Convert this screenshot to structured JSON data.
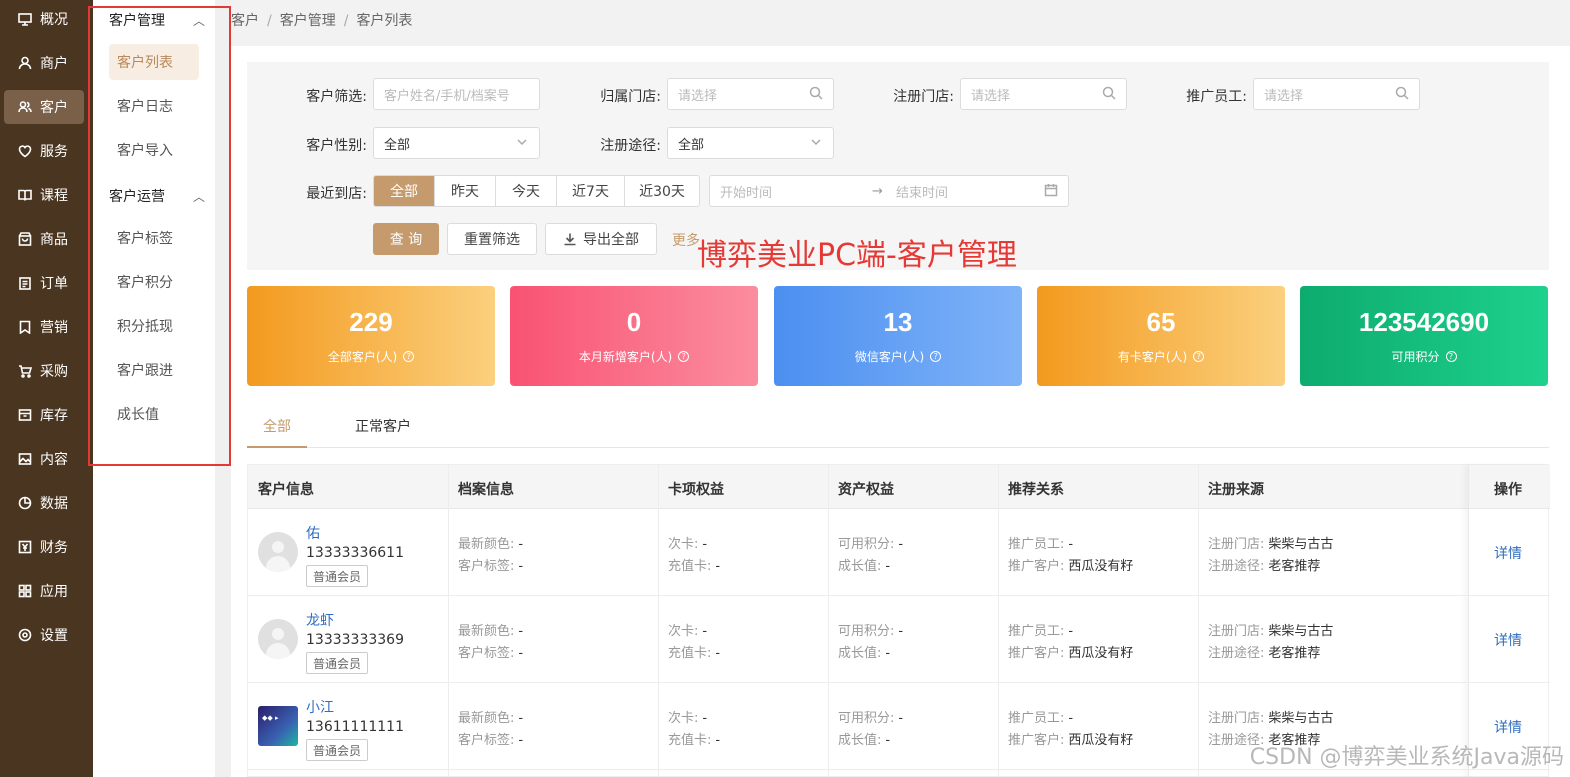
{
  "nav": {
    "items": [
      {
        "label": "概况",
        "icon": "monitor-icon"
      },
      {
        "label": "商户",
        "icon": "user-icon"
      },
      {
        "label": "客户",
        "icon": "users-icon"
      },
      {
        "label": "服务",
        "icon": "heart-icon"
      },
      {
        "label": "课程",
        "icon": "book-icon"
      },
      {
        "label": "商品",
        "icon": "bag-icon"
      },
      {
        "label": "订单",
        "icon": "clipboard-icon"
      },
      {
        "label": "营销",
        "icon": "bookmark-icon"
      },
      {
        "label": "采购",
        "icon": "cart-icon"
      },
      {
        "label": "库存",
        "icon": "box-icon"
      },
      {
        "label": "内容",
        "icon": "image-icon"
      },
      {
        "label": "数据",
        "icon": "pie-icon"
      },
      {
        "label": "财务",
        "icon": "yen-icon"
      },
      {
        "label": "应用",
        "icon": "grid-icon"
      },
      {
        "label": "设置",
        "icon": "gear-icon"
      }
    ],
    "active": "客户"
  },
  "submenu": {
    "group1": "客户管理",
    "group1_items": [
      "客户列表",
      "客户日志",
      "客户导入"
    ],
    "group2": "客户运营",
    "group2_items": [
      "客户标签",
      "客户积分",
      "积分抵现",
      "客户跟进",
      "成长值"
    ],
    "active": "客户列表"
  },
  "breadcrumb": [
    "客户",
    "客户管理",
    "客户列表"
  ],
  "filters": {
    "customer_label": "客户筛选:",
    "customer_placeholder": "客户姓名/手机/档案号",
    "home_store_label": "归属门店:",
    "home_store_placeholder": "请选择",
    "reg_store_label": "注册门店:",
    "reg_store_placeholder": "请选择",
    "promoter_label": "推广员工:",
    "promoter_placeholder": "请选择",
    "gender_label": "客户性别:",
    "gender_value": "全部",
    "channel_label": "注册途径:",
    "channel_value": "全部",
    "recent_label": "最近到店:",
    "recent_options": [
      "全部",
      "昨天",
      "今天",
      "近7天",
      "近30天"
    ],
    "recent_active": "全部",
    "start_placeholder": "开始时间",
    "arrow": "→",
    "end_placeholder": "结束时间",
    "query_btn": "查 询",
    "reset_btn": "重置筛选",
    "export_btn": "导出全部",
    "more": "更多"
  },
  "overlay_title": "博弈美业PC端-客户管理",
  "stats": [
    {
      "value": "229",
      "label": "全部客户(人)"
    },
    {
      "value": "0",
      "label": "本月新增客户(人)"
    },
    {
      "value": "13",
      "label": "微信客户(人)"
    },
    {
      "value": "65",
      "label": "有卡客户(人)"
    },
    {
      "value": "123542690",
      "label": "可用积分"
    }
  ],
  "tabs": [
    "全部",
    "正常客户"
  ],
  "table": {
    "headers": [
      "客户信息",
      "档案信息",
      "卡项权益",
      "资产权益",
      "推荐关系",
      "注册来源",
      "操作"
    ],
    "labels": {
      "color": "最新颜色:",
      "tag": "客户标签:",
      "times_card": "次卡:",
      "stored_card": "充值卡:",
      "points": "可用积分:",
      "growth": "成长值:",
      "promoter": "推广员工:",
      "promo_customer": "推广客户:",
      "reg_store": "注册门店:",
      "reg_channel": "注册途径:",
      "detail": "详情"
    },
    "rows": [
      {
        "name": "佑",
        "phone": "13333336611",
        "level": "普通会员",
        "color": "-",
        "tag": "-",
        "times_card": "-",
        "stored_card": "-",
        "points": "-",
        "growth": "-",
        "promoter": "-",
        "promo_customer": "西瓜没有籽",
        "reg_store": "柴柴与古古",
        "reg_channel": "老客推荐"
      },
      {
        "name": "龙虾",
        "phone": "13333333369",
        "level": "普通会员",
        "color": "-",
        "tag": "-",
        "times_card": "-",
        "stored_card": "-",
        "points": "-",
        "growth": "-",
        "promoter": "-",
        "promo_customer": "西瓜没有籽",
        "reg_store": "柴柴与古古",
        "reg_channel": "老客推荐"
      },
      {
        "name": "小江",
        "phone": "13611111111",
        "level": "普通会员",
        "color": "-",
        "tag": "-",
        "times_card": "-",
        "stored_card": "-",
        "points": "-",
        "growth": "-",
        "promoter": "-",
        "promo_customer": "西瓜没有籽",
        "reg_store": "柴柴与古古",
        "reg_channel": "老客推荐"
      }
    ]
  },
  "watermark": "CSDN @博弈美业系统Java源码",
  "colors": {
    "accent": "#c59a6c",
    "nav_bg": "#4a3520",
    "link": "#2f6ec0",
    "highlight": "#e53935"
  }
}
